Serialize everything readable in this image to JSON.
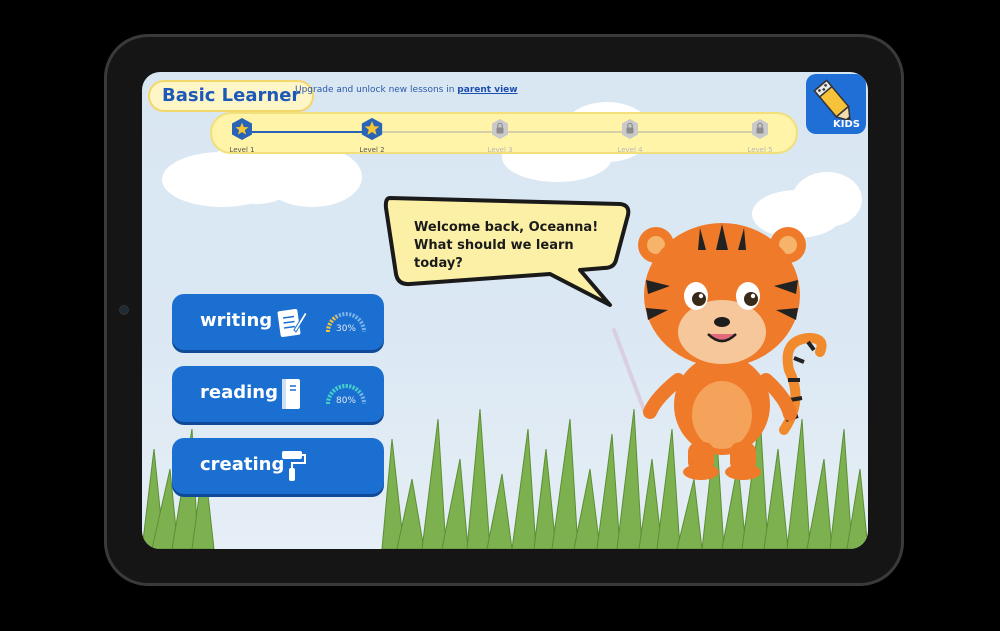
{
  "header": {
    "title": "Basic Learner",
    "upgrade_text": "Upgrade and unlock new lessons in",
    "upgrade_link": "parent view"
  },
  "levels": [
    {
      "label": "Level 1",
      "state": "completed"
    },
    {
      "label": "Level 2",
      "state": "current"
    },
    {
      "label": "Level 3",
      "state": "locked"
    },
    {
      "label": "Level 4",
      "state": "locked"
    },
    {
      "label": "Level 5",
      "state": "locked"
    }
  ],
  "app_icon": {
    "label": "KIDS",
    "color": "#1f6fd6"
  },
  "mascot": {
    "speech_line1": "Welcome back, Oceanna!",
    "speech_line2": "What should we learn today?"
  },
  "subjects": [
    {
      "label": "writing",
      "icon": "writing-pad-icon",
      "progress": 0.3,
      "progress_text": "30%"
    },
    {
      "label": "reading",
      "icon": "book-icon",
      "progress": 0.8,
      "progress_text": "80%"
    },
    {
      "label": "creating",
      "icon": "paint-roller-icon"
    }
  ],
  "colors": {
    "primary": "#1b6fd0",
    "level_bar": "#fff4a8",
    "tiger": "#ef7a2a"
  }
}
